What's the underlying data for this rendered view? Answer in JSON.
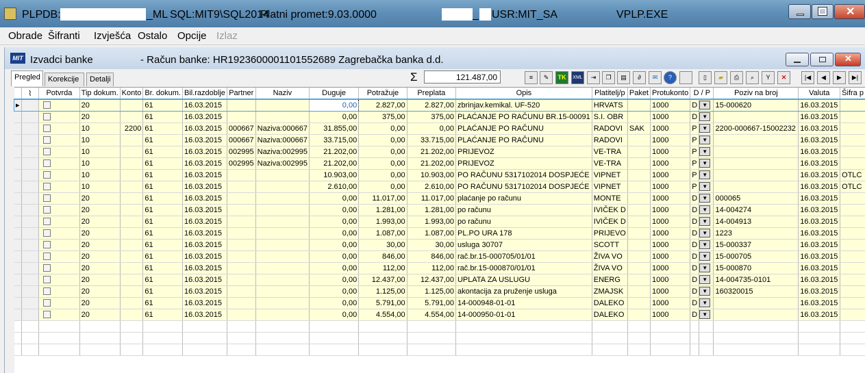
{
  "titlebar": {
    "app": "PLP",
    "db_prefix": "DB:",
    "db_suffix": "_ML",
    "sql": "SQL:MIT9\\SQL2014",
    "platni": "Platni promet:9.03.0000",
    "usr_prefix": "_",
    "usr": "USR:MIT_SA",
    "exe": "VPLP.EXE"
  },
  "menu": [
    "Obrade",
    "Šifranti",
    "Izvješća",
    "Ostalo",
    "Opcije",
    "Izlaz"
  ],
  "child": {
    "logo": "MIT",
    "title": "Izvadci banke",
    "racun": "- Račun banke: HR1923600001101552689  Zagrebačka banka d.d."
  },
  "tabs": [
    "Pregled",
    "Korekcije",
    "Detalji"
  ],
  "sum": {
    "symbol": "Σ",
    "value": "121.487,00"
  },
  "toolbar": [
    "list",
    "edit",
    "TK",
    "XML",
    "import",
    "copy",
    "grid",
    "attach",
    "mail",
    "help",
    "blank",
    "new",
    "open",
    "print",
    "find",
    "filter",
    "delete",
    "first",
    "prev",
    "next",
    "last"
  ],
  "columns": [
    "Potvrda",
    "Tip dokum.",
    "Konto",
    "Br. dokum.",
    "Bil.razdoblje",
    "Partner",
    "Naziv",
    "Duguje",
    "Potražuje",
    "Preplata",
    "Opis",
    "Platitelj/p",
    "Paket",
    "Protukonto",
    "D / P",
    "Poziv na broj",
    "Valuta",
    "Šifra p"
  ],
  "rows": [
    {
      "tip": "20",
      "konto": "",
      "br": "61",
      "bil": "16.03.2015",
      "partner": "",
      "naziv": "",
      "duguje": "0,00",
      "potrazuje": "2.827,00",
      "preplata": "2.827,00",
      "opis": "zbrinjav.kemikal. UF-520",
      "platitelj": "HRVATS",
      "paket": "",
      "protukonto": "1000",
      "dp": "D",
      "poziv": "15-000620",
      "valuta": "16.03.2015",
      "sifra": ""
    },
    {
      "tip": "20",
      "konto": "",
      "br": "61",
      "bil": "16.03.2015",
      "partner": "",
      "naziv": "",
      "duguje": "0,00",
      "potrazuje": "375,00",
      "preplata": "375,00",
      "opis": "PLAĆANJE PO RAČUNU BR.15-00091",
      "platitelj": "S.I. OBR",
      "paket": "",
      "protukonto": "1000",
      "dp": "D",
      "poziv": "",
      "valuta": "16.03.2015",
      "sifra": ""
    },
    {
      "tip": "10",
      "konto": "2200",
      "br": "61",
      "bil": "16.03.2015",
      "partner": "000667",
      "naziv": "Naziva:000667",
      "duguje": "31.855,00",
      "potrazuje": "0,00",
      "preplata": "0,00",
      "opis": "PLAĆANJE PO RAČUNU",
      "platitelj": "RADOVI",
      "paket": "SAK",
      "protukonto": "1000",
      "dp": "P",
      "poziv": "2200-000667-15002232",
      "valuta": "16.03.2015",
      "sifra": ""
    },
    {
      "tip": "10",
      "konto": "",
      "br": "61",
      "bil": "16.03.2015",
      "partner": "000667",
      "naziv": "Naziva:000667",
      "duguje": "33.715,00",
      "potrazuje": "0,00",
      "preplata": "33.715,00",
      "opis": "PLAĆANJE PO RAČUNU",
      "platitelj": "RADOVI",
      "paket": "",
      "protukonto": "1000",
      "dp": "P",
      "poziv": "",
      "valuta": "16.03.2015",
      "sifra": ""
    },
    {
      "tip": "10",
      "konto": "",
      "br": "61",
      "bil": "16.03.2015",
      "partner": "002995",
      "naziv": "Naziva:002995",
      "duguje": "21.202,00",
      "potrazuje": "0,00",
      "preplata": "21.202,00",
      "opis": "PRIJEVOZ",
      "platitelj": "VE-TRA",
      "paket": "",
      "protukonto": "1000",
      "dp": "P",
      "poziv": "",
      "valuta": "16.03.2015",
      "sifra": ""
    },
    {
      "tip": "10",
      "konto": "",
      "br": "61",
      "bil": "16.03.2015",
      "partner": "002995",
      "naziv": "Naziva:002995",
      "duguje": "21.202,00",
      "potrazuje": "0,00",
      "preplata": "21.202,00",
      "opis": "PRIJEVOZ",
      "platitelj": "VE-TRA",
      "paket": "",
      "protukonto": "1000",
      "dp": "P",
      "poziv": "",
      "valuta": "16.03.2015",
      "sifra": ""
    },
    {
      "tip": "10",
      "konto": "",
      "br": "61",
      "bil": "16.03.2015",
      "partner": "",
      "naziv": "",
      "duguje": "10.903,00",
      "potrazuje": "0,00",
      "preplata": "10.903,00",
      "opis": "PO RAČUNU 5317102014 DOSPJEĆE",
      "platitelj": "VIPNET",
      "paket": "",
      "protukonto": "1000",
      "dp": "P",
      "poziv": "",
      "valuta": "16.03.2015",
      "sifra": "OTLC"
    },
    {
      "tip": "10",
      "konto": "",
      "br": "61",
      "bil": "16.03.2015",
      "partner": "",
      "naziv": "",
      "duguje": "2.610,00",
      "potrazuje": "0,00",
      "preplata": "2.610,00",
      "opis": "PO RAČUNU 5317102014 DOSPJEĆE",
      "platitelj": "VIPNET",
      "paket": "",
      "protukonto": "1000",
      "dp": "P",
      "poziv": "",
      "valuta": "16.03.2015",
      "sifra": "OTLC"
    },
    {
      "tip": "20",
      "konto": "",
      "br": "61",
      "bil": "16.03.2015",
      "partner": "",
      "naziv": "",
      "duguje": "0,00",
      "potrazuje": "11.017,00",
      "preplata": "11.017,00",
      "opis": "plaćanje po računu",
      "platitelj": "MONTE",
      "paket": "",
      "protukonto": "1000",
      "dp": "D",
      "poziv": "000065",
      "valuta": "16.03.2015",
      "sifra": ""
    },
    {
      "tip": "20",
      "konto": "",
      "br": "61",
      "bil": "16.03.2015",
      "partner": "",
      "naziv": "",
      "duguje": "0,00",
      "potrazuje": "1.281,00",
      "preplata": "1.281,00",
      "opis": "po računu",
      "platitelj": "IVIČEK D",
      "paket": "",
      "protukonto": "1000",
      "dp": "D",
      "poziv": "14-004274",
      "valuta": "16.03.2015",
      "sifra": ""
    },
    {
      "tip": "20",
      "konto": "",
      "br": "61",
      "bil": "16.03.2015",
      "partner": "",
      "naziv": "",
      "duguje": "0,00",
      "potrazuje": "1.993,00",
      "preplata": "1.993,00",
      "opis": "po računu",
      "platitelj": "IVIČEK D",
      "paket": "",
      "protukonto": "1000",
      "dp": "D",
      "poziv": "14-004913",
      "valuta": "16.03.2015",
      "sifra": ""
    },
    {
      "tip": "20",
      "konto": "",
      "br": "61",
      "bil": "16.03.2015",
      "partner": "",
      "naziv": "",
      "duguje": "0,00",
      "potrazuje": "1.087,00",
      "preplata": "1.087,00",
      "opis": "PL.PO URA 178",
      "platitelj": "PRIJEVO",
      "paket": "",
      "protukonto": "1000",
      "dp": "D",
      "poziv": "1223",
      "valuta": "16.03.2015",
      "sifra": ""
    },
    {
      "tip": "20",
      "konto": "",
      "br": "61",
      "bil": "16.03.2015",
      "partner": "",
      "naziv": "",
      "duguje": "0,00",
      "potrazuje": "30,00",
      "preplata": "30,00",
      "opis": "usluga 30707",
      "platitelj": "SCOTT",
      "paket": "",
      "protukonto": "1000",
      "dp": "D",
      "poziv": "15-000337",
      "valuta": "16.03.2015",
      "sifra": ""
    },
    {
      "tip": "20",
      "konto": "",
      "br": "61",
      "bil": "16.03.2015",
      "partner": "",
      "naziv": "",
      "duguje": "0,00",
      "potrazuje": "846,00",
      "preplata": "846,00",
      "opis": "rač.br.15-000705/01/01",
      "platitelj": "ŽIVA VO",
      "paket": "",
      "protukonto": "1000",
      "dp": "D",
      "poziv": "15-000705",
      "valuta": "16.03.2015",
      "sifra": ""
    },
    {
      "tip": "20",
      "konto": "",
      "br": "61",
      "bil": "16.03.2015",
      "partner": "",
      "naziv": "",
      "duguje": "0,00",
      "potrazuje": "112,00",
      "preplata": "112,00",
      "opis": "rač.br.15-000870/01/01",
      "platitelj": "ŽIVA VO",
      "paket": "",
      "protukonto": "1000",
      "dp": "D",
      "poziv": "15-000870",
      "valuta": "16.03.2015",
      "sifra": ""
    },
    {
      "tip": "20",
      "konto": "",
      "br": "61",
      "bil": "16.03.2015",
      "partner": "",
      "naziv": "",
      "duguje": "0,00",
      "potrazuje": "12.437,00",
      "preplata": "12.437,00",
      "opis": "UPLATA ZA USLUGU",
      "platitelj": "ENERG",
      "paket": "",
      "protukonto": "1000",
      "dp": "D",
      "poziv": "14-004735-0101",
      "valuta": "16.03.2015",
      "sifra": ""
    },
    {
      "tip": "20",
      "konto": "",
      "br": "61",
      "bil": "16.03.2015",
      "partner": "",
      "naziv": "",
      "duguje": "0,00",
      "potrazuje": "1.125,00",
      "preplata": "1.125,00",
      "opis": "akontacija za pruženje usluga",
      "platitelj": "ZMAJSK",
      "paket": "",
      "protukonto": "1000",
      "dp": "D",
      "poziv": "160320015",
      "valuta": "16.03.2015",
      "sifra": ""
    },
    {
      "tip": "20",
      "konto": "",
      "br": "61",
      "bil": "16.03.2015",
      "partner": "",
      "naziv": "",
      "duguje": "0,00",
      "potrazuje": "5.791,00",
      "preplata": "5.791,00",
      "opis": "14-000948-01-01",
      "platitelj": "DALEKO",
      "paket": "",
      "protukonto": "1000",
      "dp": "D",
      "poziv": "",
      "valuta": "16.03.2015",
      "sifra": ""
    },
    {
      "tip": "20",
      "konto": "",
      "br": "61",
      "bil": "16.03.2015",
      "partner": "",
      "naziv": "",
      "duguje": "0,00",
      "potrazuje": "4.554,00",
      "preplata": "4.554,00",
      "opis": "14-000950-01-01",
      "platitelj": "DALEKO",
      "paket": "",
      "protukonto": "1000",
      "dp": "D",
      "poziv": "",
      "valuta": "16.03.2015",
      "sifra": ""
    }
  ]
}
